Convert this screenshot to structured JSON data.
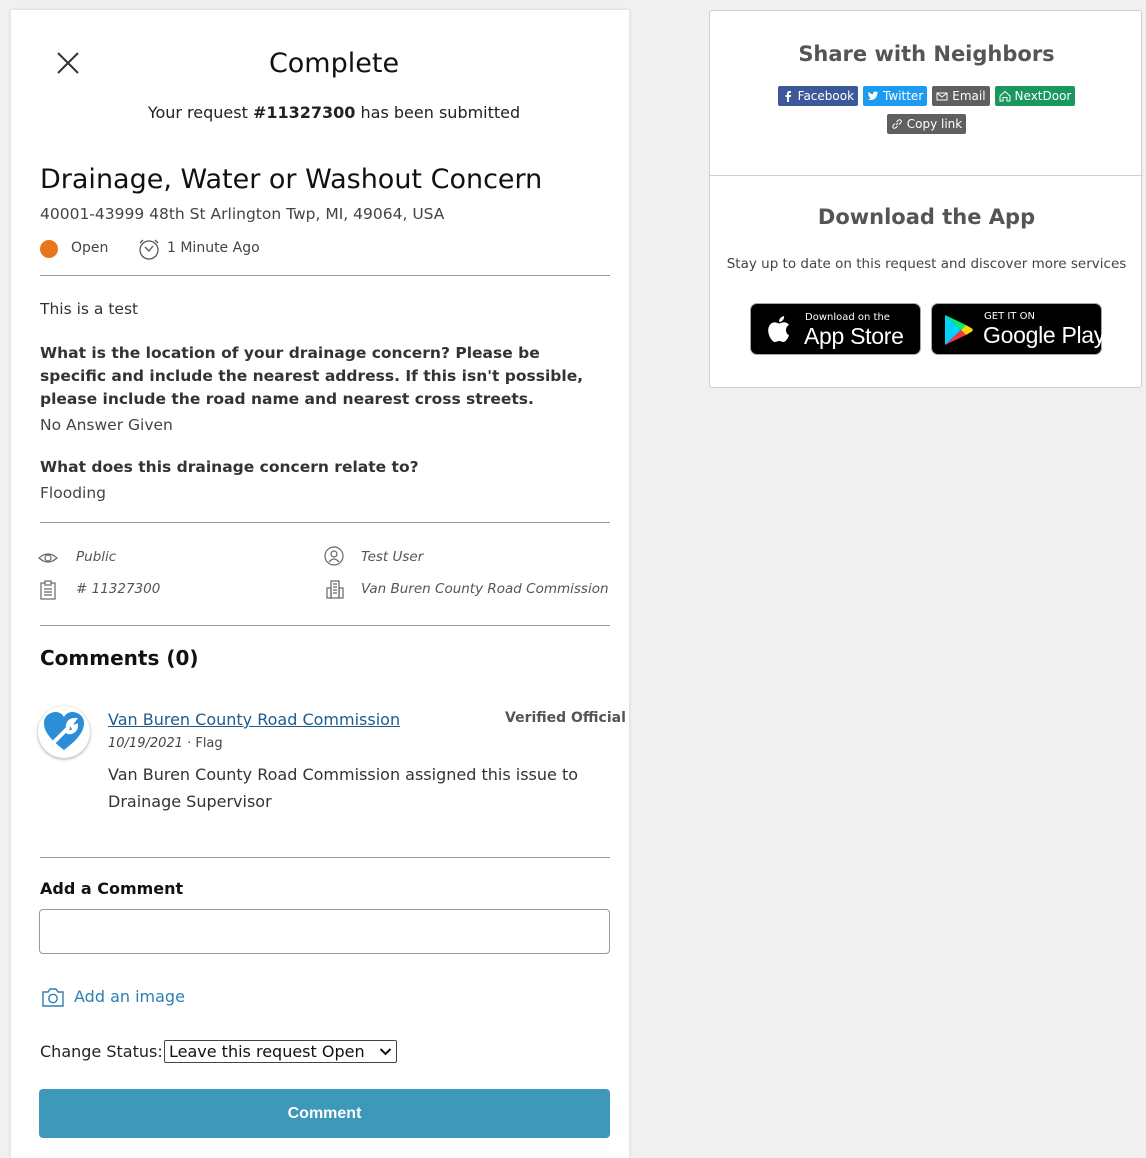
{
  "header": {
    "title": "Complete",
    "submitted_prefix": "Your request ",
    "request_number": "#11327300",
    "submitted_suffix": " has been submitted"
  },
  "request": {
    "title": "Drainage, Water or Washout Concern",
    "address": "40001-43999 48th St Arlington Twp, MI, 49064, USA",
    "status": "Open",
    "status_color": "#e8761a",
    "time": "1 Minute Ago",
    "description": "This is a test",
    "questions": [
      {
        "question": "What is the location of your drainage concern? Please be specific and include the nearest address. If this isn't possible, please include the road name and nearest cross streets.",
        "answer": "No Answer Given"
      },
      {
        "question": "What does this drainage concern relate to?",
        "answer": "Flooding"
      }
    ]
  },
  "meta": {
    "visibility": "Public",
    "user": "Test User",
    "id": "# 11327300",
    "organization": "Van Buren County Road Commission"
  },
  "comments": {
    "heading": "Comments (0)",
    "items": [
      {
        "author": "Van Buren County Road Commission",
        "badge": "Verified Official",
        "date": "10/19/2021",
        "separator": " · ",
        "flag": "Flag",
        "body": "Van Buren County Road Commission assigned this issue to Drainage Supervisor"
      }
    ]
  },
  "add_comment": {
    "heading": "Add a Comment",
    "input_value": "",
    "add_image": "Add an image",
    "change_status_label": "Change Status:",
    "status_selected": "Leave this request Open",
    "submit_label": "Comment"
  },
  "share": {
    "heading": "Share with Neighbors",
    "buttons": {
      "facebook": "Facebook",
      "twitter": "Twitter",
      "email": "Email",
      "nextdoor": "NextDoor",
      "copy": "Copy link"
    }
  },
  "app": {
    "heading": "Download the App",
    "subtitle": "Stay up to date on this request and discover more services",
    "appstore_small": "Download on the",
    "appstore_big": "App Store",
    "googleplay_small": "GET IT ON",
    "googleplay_big": "Google Play"
  },
  "icons": [
    "close-icon",
    "clock-icon",
    "eye-icon",
    "user-icon",
    "clipboard-icon",
    "building-icon",
    "camera-icon",
    "chevron-down-icon",
    "facebook-icon",
    "twitter-icon",
    "email-icon",
    "nextdoor-icon",
    "link-icon",
    "apple-icon",
    "google-play-icon",
    "wrench-heart-icon"
  ]
}
